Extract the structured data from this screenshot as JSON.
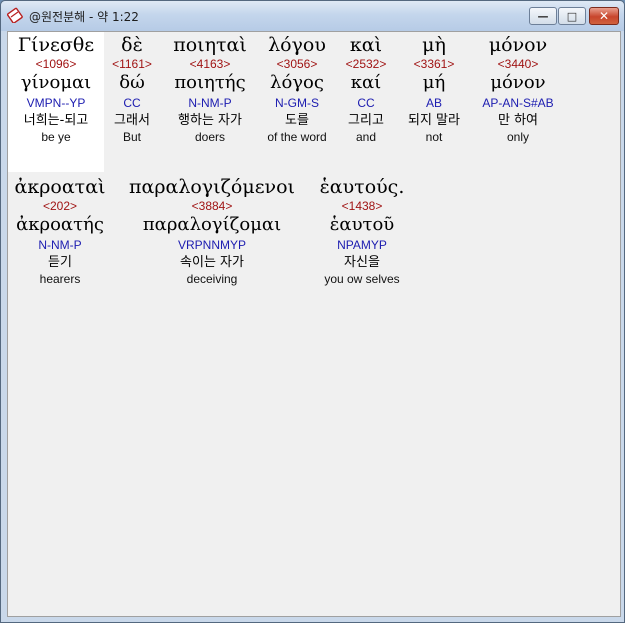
{
  "window": {
    "title": "@원전분해 - 약 1:22",
    "min_symbol": "—",
    "max_symbol": "□",
    "close_symbol": "✕"
  },
  "line1": [
    {
      "greek": "Γίνεσθε",
      "strong": "<1096>",
      "lemma": "γίνομαι",
      "morph": "VMPN--YP",
      "korean": "너희는-되고",
      "english": "be ye"
    },
    {
      "greek": "δὲ",
      "strong": "<1161>",
      "lemma": "δώ",
      "morph": "CC",
      "korean": "그래서",
      "english": "But"
    },
    {
      "greek": "ποιηταὶ",
      "strong": "<4163>",
      "lemma": "ποιητής",
      "morph": "N-NM-P",
      "korean": "행하는 자가",
      "english": "doers"
    },
    {
      "greek": "λόγου",
      "strong": "<3056>",
      "lemma": "λόγος",
      "morph": "N-GM-S",
      "korean": "도를",
      "english": "of the word"
    },
    {
      "greek": "καὶ",
      "strong": "<2532>",
      "lemma": "καί",
      "morph": "CC",
      "korean": "그리고",
      "english": "and"
    },
    {
      "greek": "μὴ",
      "strong": "<3361>",
      "lemma": "μή",
      "morph": "AB",
      "korean": "되지 말라",
      "english": "not"
    },
    {
      "greek": "μόνον",
      "strong": "<3440>",
      "lemma": "μόνον",
      "morph": "AP-AN-S#AB",
      "korean": "만 하여",
      "english": "only"
    }
  ],
  "line2": [
    {
      "greek": "ἀκροαταὶ",
      "strong": "<202>",
      "lemma": "ἀκροατής",
      "morph": "N-NM-P",
      "korean": "듣기",
      "english": "hearers"
    },
    {
      "greek": "παραλογιζόμενοι",
      "strong": "<3884>",
      "lemma": "παραλογίζομαι",
      "morph": "VRPNNMYP",
      "korean": "속이는 자가",
      "english": "deceiving"
    },
    {
      "greek": "ἑαυτούς.",
      "strong": "<1438>",
      "lemma": "ἑαυτοῦ",
      "morph": "NPAMYP",
      "korean": "자신을",
      "english": "you ow selves"
    }
  ],
  "colors": {
    "strong": "#a01414",
    "morph": "#1c1cb0",
    "selection": "#ffffff"
  },
  "icons": {
    "app": "book-icon"
  }
}
